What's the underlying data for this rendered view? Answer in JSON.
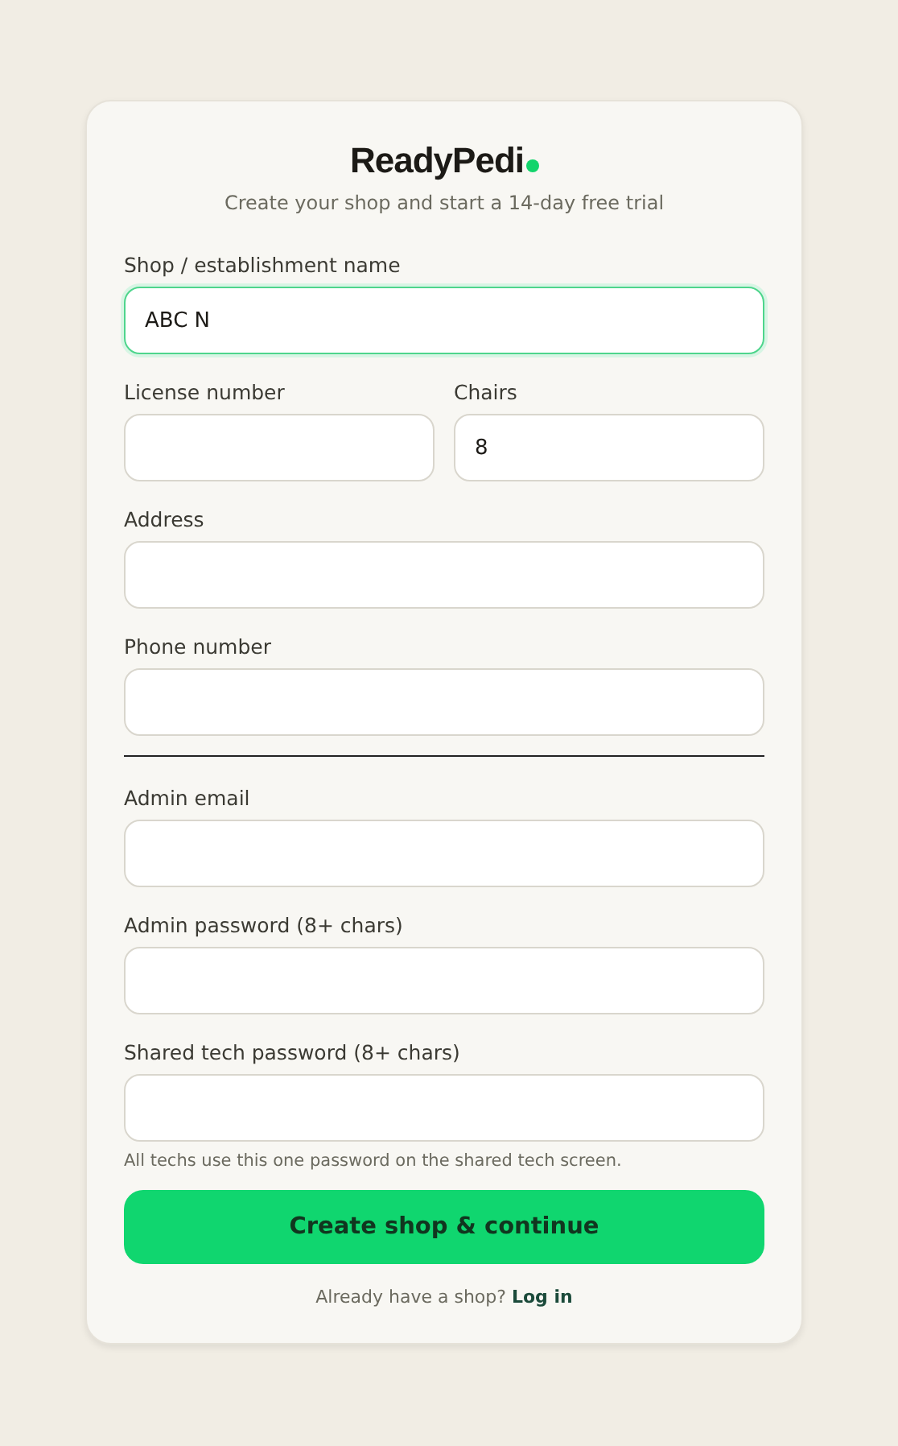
{
  "brand": {
    "name": "ReadyPedi",
    "tagline": "Create your shop and start a 14-day free trial"
  },
  "sections": [
    {
      "rows": [
        [
          {
            "label": "Shop / establishment name",
            "value": "ABC N",
            "focused": true
          }
        ],
        [
          {
            "label": "License number",
            "focused": false
          },
          {
            "label": "Chairs",
            "value": "8",
            "focused": false
          }
        ],
        [
          {
            "label": "Address",
            "focused": false
          }
        ],
        [
          {
            "label": "Phone number",
            "focused": false
          }
        ]
      ]
    },
    {
      "rows": [
        [
          {
            "label": "Admin email",
            "focused": false
          }
        ],
        [
          {
            "label": "Admin password (8+ chars)",
            "focused": false
          }
        ],
        [
          {
            "label": "Shared tech password (8+ chars)",
            "focused": false
          }
        ]
      ]
    }
  ],
  "hint": "All techs use this one password on the shared tech screen.",
  "submit": "Create shop & continue",
  "footer": {
    "text": "Already have a shop?",
    "link": "Log in"
  }
}
